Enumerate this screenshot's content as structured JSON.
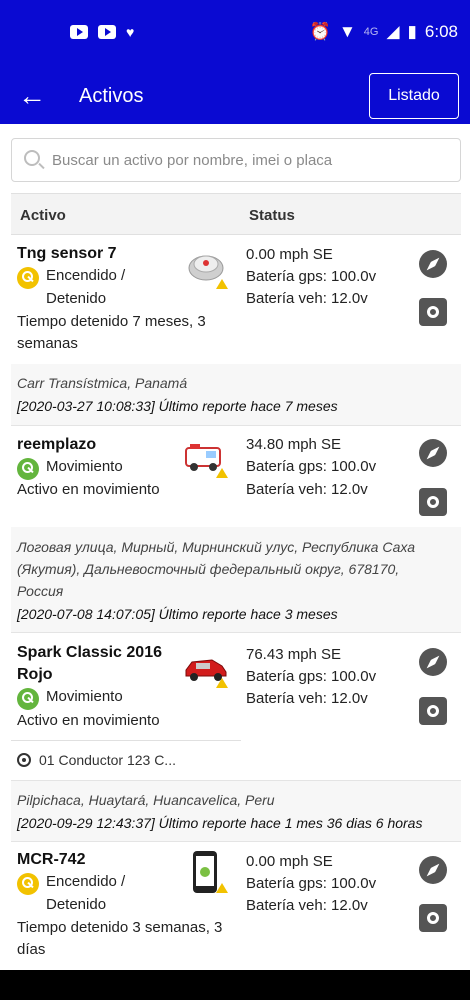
{
  "status_bar": {
    "time": "6:08",
    "network": "4G"
  },
  "appbar": {
    "title": "Activos",
    "list_button": "Listado"
  },
  "search": {
    "placeholder": "Buscar un activo por nombre, imei o placa"
  },
  "table": {
    "col_active": "Activo",
    "col_status": "Status"
  },
  "assets": [
    {
      "name": "Tng sensor 7",
      "state_line1": "Encendido /",
      "state_line2": "Detenido",
      "detail_line1": "Tiempo detenido 7 meses, 3",
      "detail_line2": "semanas",
      "speed": "0.00 mph SE",
      "battery_gps": "Batería gps: 100.0v",
      "battery_veh": "Batería veh: 12.0v",
      "address": "Carr Transístmica, Panamá",
      "report": "[2020-03-27 10:08:33] Último reporte hace 7 meses",
      "key_color": "#f2c200"
    },
    {
      "name": "reemplazo",
      "state_line1": "Movimiento",
      "detail_line1": "Activo en movimiento",
      "speed": "34.80 mph SE",
      "battery_gps": "Batería gps: 100.0v",
      "battery_veh": "Batería veh: 12.0v",
      "address_line1": "Логовая улица, Мирный, Мирнинский улус, Республика Саха",
      "address_line2": "(Якутия), Дальневосточный федеральный округ, 678170,",
      "address_line3": "Россия",
      "report": "[2020-07-08 14:07:05] Último reporte hace 3 meses",
      "key_color": "#63b53d"
    },
    {
      "name_line1": "Spark Classic 2016",
      "name_line2": "Rojo",
      "state_line1": "Movimiento",
      "detail_line1": "Activo en movimiento",
      "speed": "76.43 mph SE",
      "battery_gps": "Batería gps: 100.0v",
      "battery_veh": "Batería veh: 12.0v",
      "driver": "01 Conductor 123 C...",
      "address": "Pilpichaca, Huaytará, Huancavelica, Peru",
      "report": "[2020-09-29 12:43:37] Último reporte hace 1 mes 36 dias 6 horas",
      "key_color": "#63b53d"
    },
    {
      "name": "MCR-742",
      "state_line1": "Encendido /",
      "state_line2": "Detenido",
      "detail_line1": "Tiempo detenido 3 semanas, 3",
      "detail_line2": "días",
      "speed": "0.00 mph SE",
      "battery_gps": "Batería gps: 100.0v",
      "battery_veh": "Batería veh: 12.0v",
      "key_color": "#f2c200"
    }
  ],
  "colors": {
    "primary": "#0a0ad2"
  }
}
